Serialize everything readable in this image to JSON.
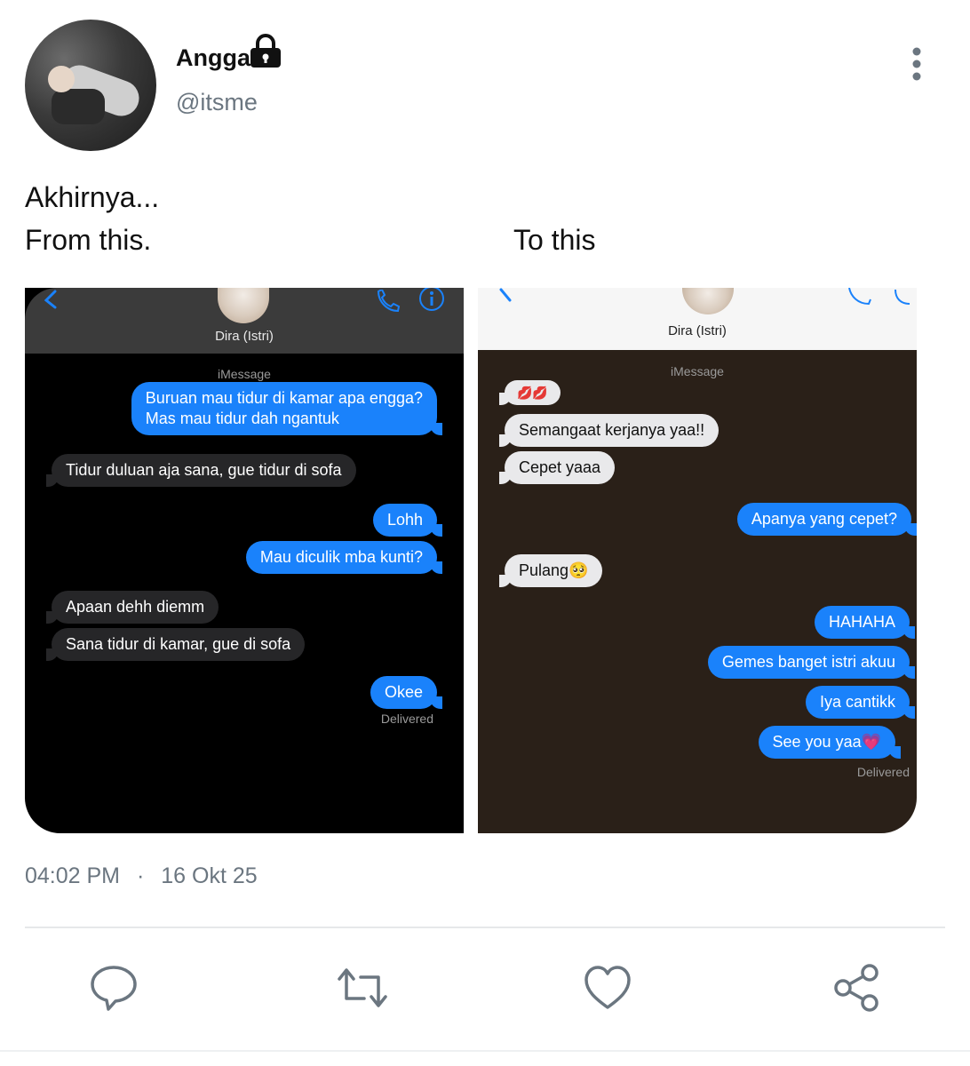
{
  "author": {
    "name": "Angga",
    "handle": "@itsme",
    "avatar_icon": "profile-photo",
    "locked_icon": "lock-icon"
  },
  "tweet": {
    "line1": "Akhirnya...",
    "line2_left": "From this.",
    "line2_right": "To this",
    "timestamp_time": "04:02 PM",
    "separator": "·",
    "timestamp_date": "16 Okt 25"
  },
  "screenshot_left": {
    "contact_name": "Dira (Istri)",
    "service_label": "iMessage",
    "messages": [
      {
        "dir": "sent",
        "lines": [
          "Buruan mau tidur di kamar apa engga?",
          "Mas mau tidur dah ngantuk"
        ]
      },
      {
        "dir": "recv",
        "text": "Tidur duluan aja sana, gue tidur di sofa"
      },
      {
        "dir": "sent",
        "text": "Lohh"
      },
      {
        "dir": "sent",
        "text": "Mau diculik mba kunti?"
      },
      {
        "dir": "recv",
        "text": "Apaan dehh diemm"
      },
      {
        "dir": "recv",
        "text": "Sana tidur di kamar, gue di sofa"
      },
      {
        "dir": "sent",
        "text": "Okee"
      }
    ],
    "status": "Delivered"
  },
  "screenshot_right": {
    "contact_name": "Dira (Istri)",
    "service_label": "iMessage",
    "messages": [
      {
        "dir": "recv",
        "text": "💋💋"
      },
      {
        "dir": "recv",
        "text": "Semangaat kerjanya yaa!!"
      },
      {
        "dir": "recv",
        "text": "Cepet yaaa"
      },
      {
        "dir": "sent",
        "text": "Apanya yang cepet?"
      },
      {
        "dir": "recv",
        "text": "Pulang🥺"
      },
      {
        "dir": "sent",
        "text": "HAHAHA"
      },
      {
        "dir": "sent",
        "text": "Gemes banget istri akuu"
      },
      {
        "dir": "sent",
        "text": "Iya cantikk"
      },
      {
        "dir": "sent",
        "text": "See you yaa💗"
      }
    ],
    "status": "Delivered"
  },
  "actions": [
    "reply-icon",
    "retweet-icon",
    "like-icon",
    "share-icon"
  ],
  "colors": {
    "imessage_blue": "#1a82fb",
    "handle_gray": "#6b7680",
    "right_background": "#2a2018"
  }
}
